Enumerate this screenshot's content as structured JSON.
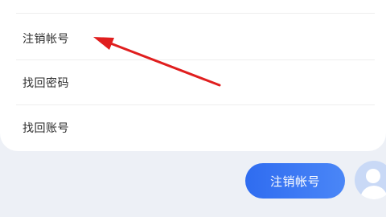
{
  "menu": {
    "items": [
      {
        "label": "注销帐号"
      },
      {
        "label": "找回密码"
      },
      {
        "label": "找回账号"
      }
    ]
  },
  "chat": {
    "reply_text": "注销帐号"
  },
  "colors": {
    "accent_blue": "#2f6cf0",
    "annotation_arrow": "#e01e1e"
  },
  "icons": {
    "avatar": "user-avatar-icon",
    "arrow": "red-annotation-arrow"
  }
}
